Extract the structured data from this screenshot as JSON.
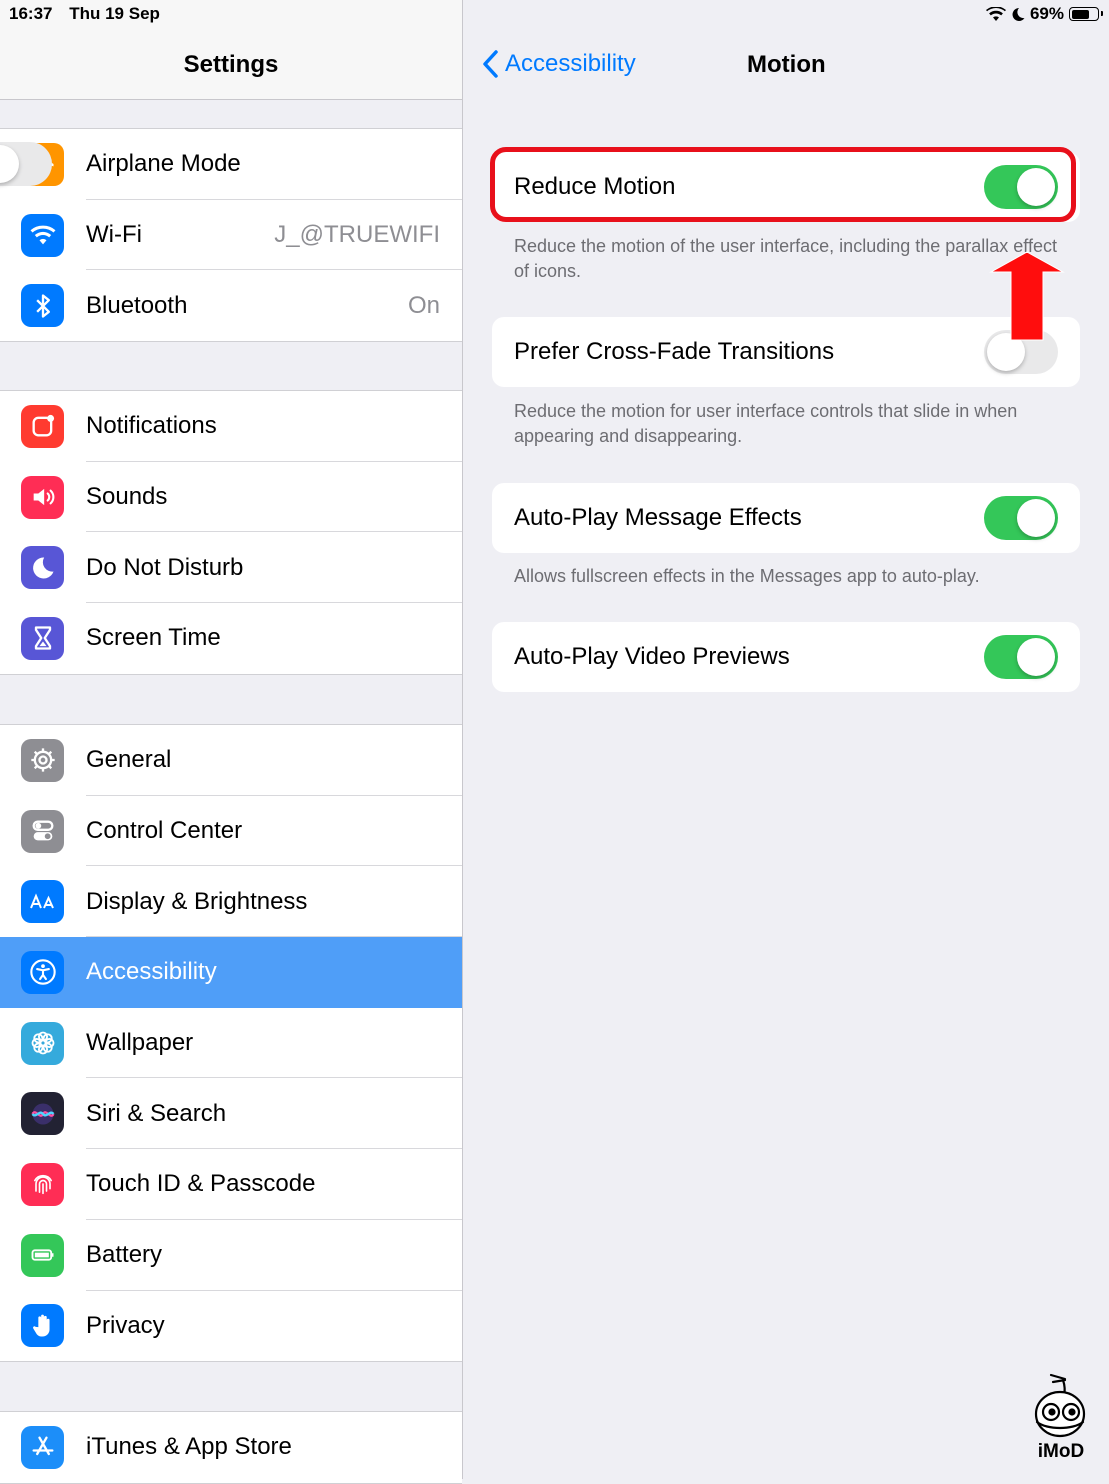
{
  "status_bar": {
    "time": "16:37",
    "date": "Thu 19 Sep",
    "battery": "69%"
  },
  "master": {
    "title": "Settings",
    "groups": [
      [
        {
          "label": "Airplane Mode",
          "icon": "airplane-icon",
          "color": "#ff9500",
          "toggle": "off"
        },
        {
          "label": "Wi-Fi",
          "icon": "wifi-icon",
          "color": "#007aff",
          "value": "J_@TRUEWIFI"
        },
        {
          "label": "Bluetooth",
          "icon": "bluetooth-icon",
          "color": "#007aff",
          "value": "On"
        }
      ],
      [
        {
          "label": "Notifications",
          "icon": "notifications-icon",
          "color": "#ff3b30"
        },
        {
          "label": "Sounds",
          "icon": "speaker-icon",
          "color": "#ff2d55"
        },
        {
          "label": "Do Not Disturb",
          "icon": "moon-icon",
          "color": "#5856d6"
        },
        {
          "label": "Screen Time",
          "icon": "hourglass-icon",
          "color": "#5856d6"
        }
      ],
      [
        {
          "label": "General",
          "icon": "gear-icon",
          "color": "#8e8e93"
        },
        {
          "label": "Control Center",
          "icon": "toggles-icon",
          "color": "#8e8e93"
        },
        {
          "label": "Display & Brightness",
          "icon": "text-size-icon",
          "color": "#007aff"
        },
        {
          "label": "Accessibility",
          "icon": "accessibility-icon",
          "color": "#4f9ef8",
          "selected": true
        },
        {
          "label": "Wallpaper",
          "icon": "flower-icon",
          "color": "#35aadc"
        },
        {
          "label": "Siri & Search",
          "icon": "siri-icon",
          "color": "#222233"
        },
        {
          "label": "Touch ID & Passcode",
          "icon": "fingerprint-icon",
          "color": "#ff2d55"
        },
        {
          "label": "Battery",
          "icon": "battery-icon",
          "color": "#34c759"
        },
        {
          "label": "Privacy",
          "icon": "hand-icon",
          "color": "#007aff"
        }
      ],
      [
        {
          "label": "iTunes & App Store",
          "icon": "app-store-icon",
          "color": "#1c8ef9"
        }
      ]
    ]
  },
  "detail": {
    "back_label": "Accessibility",
    "title": "Motion",
    "settings": [
      {
        "label": "Reduce Motion",
        "toggle": "on",
        "footer": "Reduce the motion of the user interface, including the parallax effect of icons."
      },
      {
        "label": "Prefer Cross-Fade Transitions",
        "toggle": "off",
        "footer": "Reduce the motion for user interface controls that slide in when appearing and disappearing."
      },
      {
        "label": "Auto-Play Message Effects",
        "toggle": "on",
        "footer": "Allows fullscreen effects in the Messages app to auto-play."
      },
      {
        "label": "Auto-Play Video Previews",
        "toggle": "on",
        "footer": ""
      }
    ],
    "highlight_color": "#e8101b",
    "watermark": "iMoD"
  }
}
